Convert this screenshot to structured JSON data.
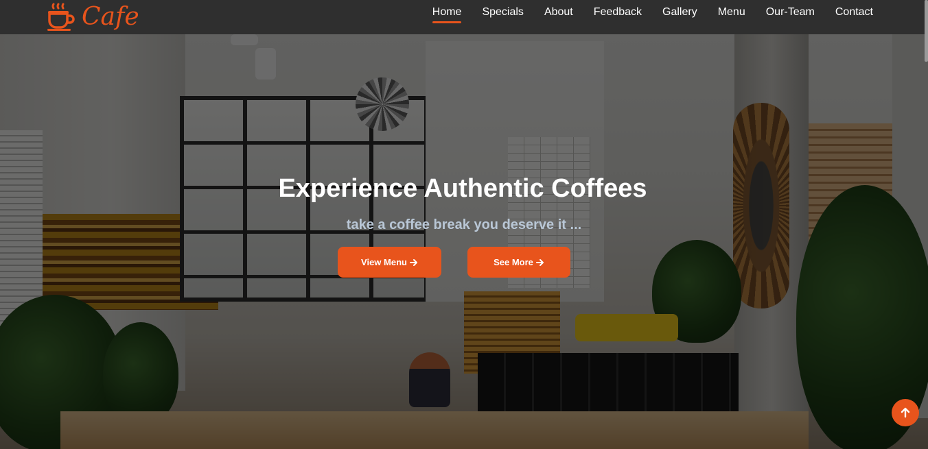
{
  "brand": {
    "name": "Cafe",
    "logo_icon": "coffee-cup-icon",
    "accent_color": "#e8541c"
  },
  "nav": {
    "items": [
      {
        "label": "Home",
        "active": true
      },
      {
        "label": "Specials"
      },
      {
        "label": "About"
      },
      {
        "label": "Feedback"
      },
      {
        "label": "Gallery"
      },
      {
        "label": "Menu"
      },
      {
        "label": "Our-Team"
      },
      {
        "label": "Contact"
      }
    ]
  },
  "hero": {
    "title": "Experience Authentic Coffees",
    "subtitle": "take a coffee break you deserve it ...",
    "primary_button": "View Menu",
    "secondary_button": "See More",
    "button_icon": "arrow-right-icon"
  },
  "scroll_top": {
    "icon": "arrow-up-icon"
  }
}
